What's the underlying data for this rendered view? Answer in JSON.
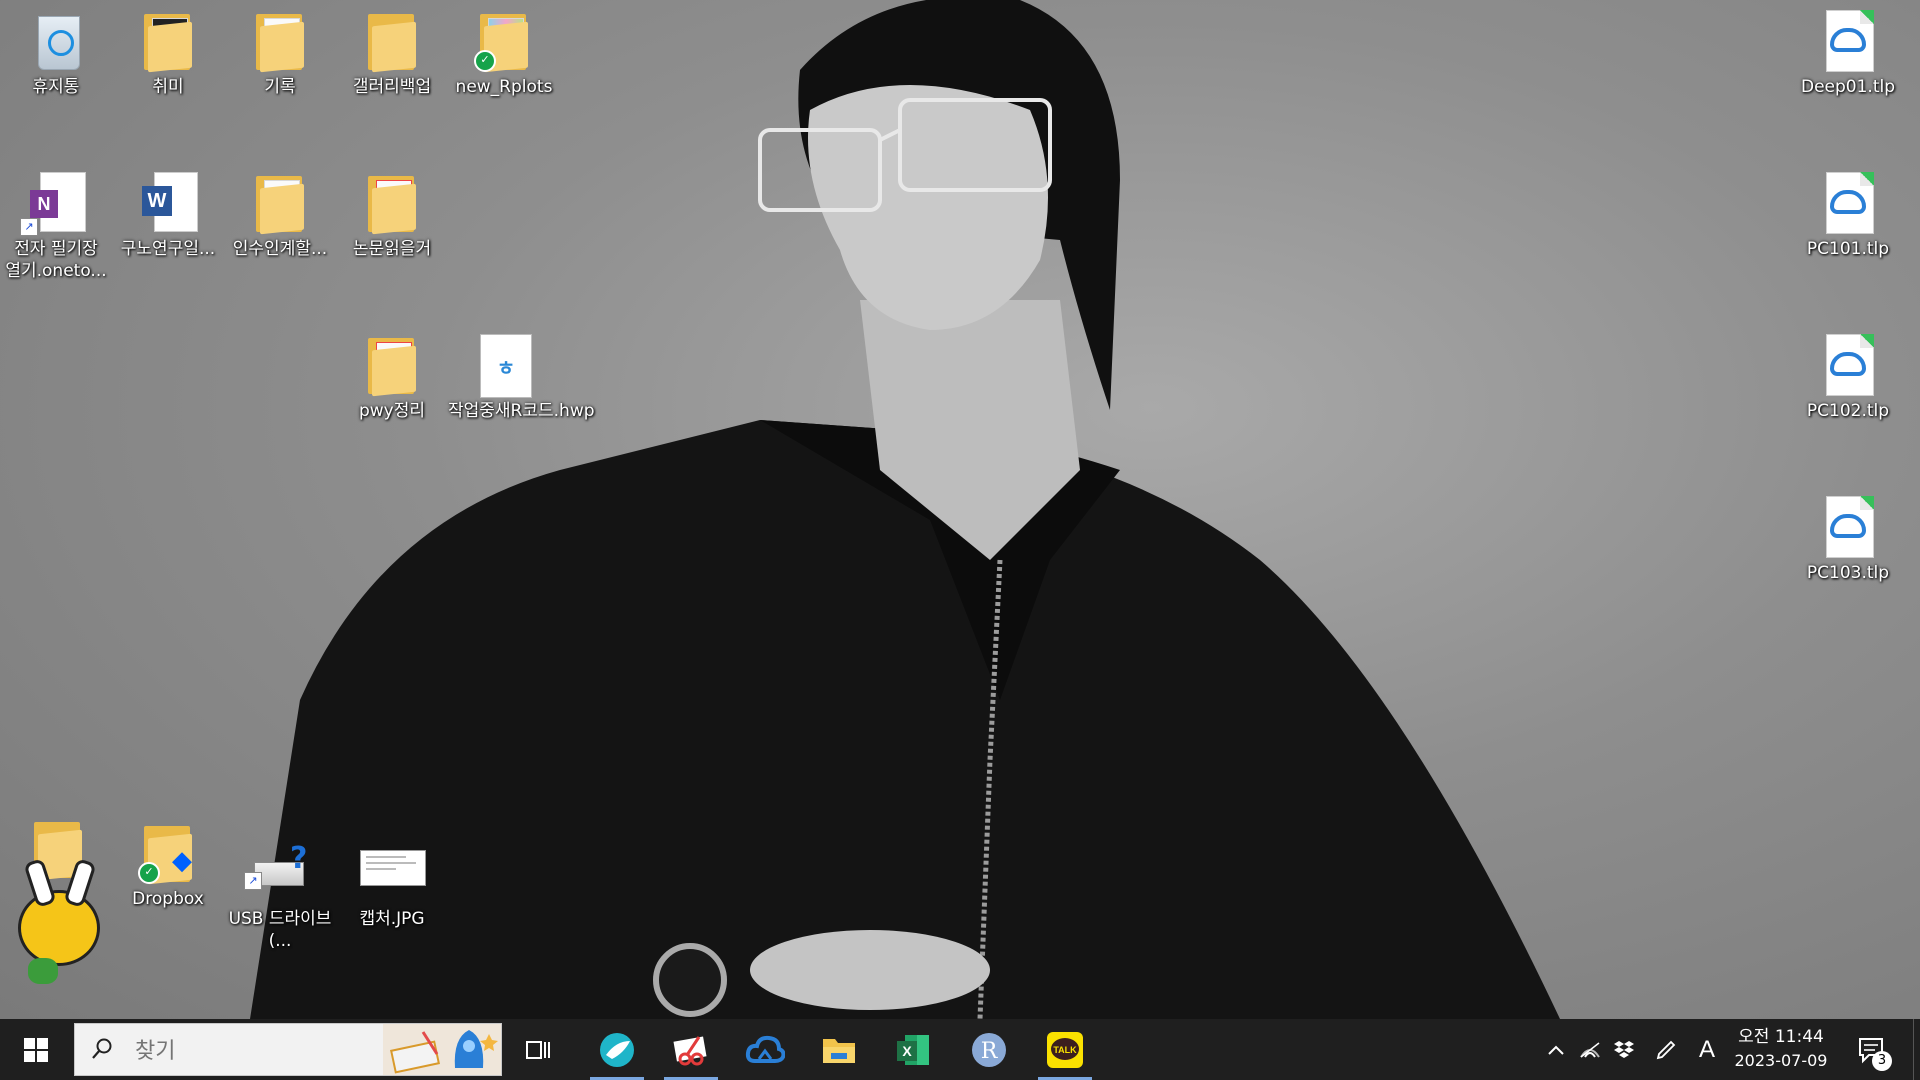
{
  "desktop": {
    "left_icons": [
      {
        "name": "recycle-bin",
        "label": "휴지통"
      },
      {
        "name": "folder-hobby",
        "label": "취미"
      },
      {
        "name": "folder-record",
        "label": "기록"
      },
      {
        "name": "folder-gallery-backup",
        "label": "갤러리백업"
      },
      {
        "name": "folder-new-rplots",
        "label": "new_Rplots"
      },
      {
        "name": "onenote-shortcut",
        "label": "전자 필기장 열기.oneto..."
      },
      {
        "name": "word-doc",
        "label": "구노연구일..."
      },
      {
        "name": "folder-handover",
        "label": "인수인계할..."
      },
      {
        "name": "folder-paper-reading",
        "label": "논문읽을거"
      },
      {
        "name": "folder-pwy",
        "label": "pwy정리"
      },
      {
        "name": "hwp-doc",
        "label": "작업중새R코드.hwp"
      },
      {
        "name": "dropbox-folder",
        "label": "Dropbox"
      },
      {
        "name": "usb-drive-shortcut",
        "label": "USB 드라이브 (..."
      },
      {
        "name": "capture-image",
        "label": "캡처.JPG"
      }
    ],
    "right_icons": [
      {
        "name": "tlp-deep01",
        "label": "Deep01.tlp"
      },
      {
        "name": "tlp-pc101",
        "label": "PC101.tlp"
      },
      {
        "name": "tlp-pc102",
        "label": "PC102.tlp"
      },
      {
        "name": "tlp-pc103",
        "label": "PC103.tlp"
      }
    ]
  },
  "taskbar": {
    "search_placeholder": "찾기",
    "apps": [
      {
        "name": "task-view-icon"
      },
      {
        "name": "blue-bird-app-icon"
      },
      {
        "name": "snipping-tool-icon"
      },
      {
        "name": "cloud-app-icon"
      },
      {
        "name": "file-explorer-icon"
      },
      {
        "name": "excel-icon"
      },
      {
        "name": "r-app-icon"
      },
      {
        "name": "kakaotalk-icon",
        "text": "TALK"
      }
    ],
    "tray": {
      "ime_label": "A",
      "time": "오전 11:44",
      "date": "2023-07-09",
      "notification_count": "3"
    }
  },
  "colors": {
    "taskbar_bg": "#1f1f1f",
    "folder_yellow": "#f6d27a",
    "accent_blue": "#2a7fd6",
    "excel_green": "#1e7145",
    "kakao_yellow": "#fae100"
  }
}
